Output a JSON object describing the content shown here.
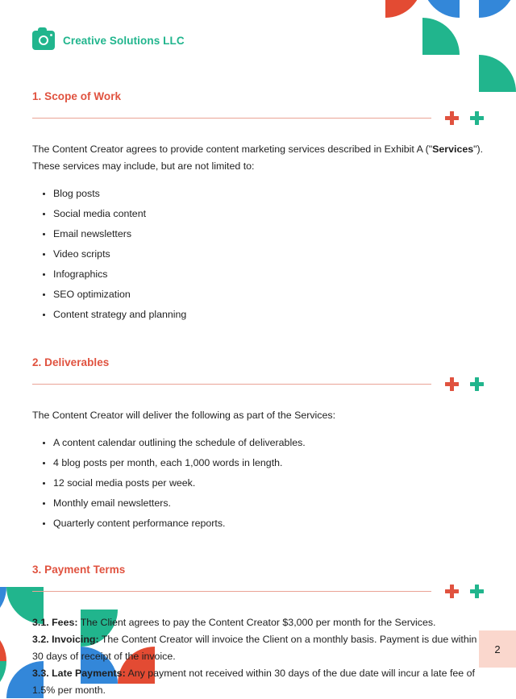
{
  "brand": {
    "name": "Creative Solutions LLC",
    "logo_icon": "camera-icon",
    "color": "#21b58d"
  },
  "theme": {
    "accent_red": "#e0523f",
    "accent_teal": "#21b58d",
    "accent_blue": "#3387d9",
    "rule_color": "#eaa396",
    "page_badge_bg": "#fad7cd"
  },
  "sections": [
    {
      "title": "1. Scope of Work",
      "intro": "The Content Creator agrees to provide content marketing services described in Exhibit A (\"Services\"). These services may include, but are not limited to:",
      "intro_pre": "The Content Creator agrees to provide content marketing services described in Exhibit A (\"",
      "intro_bold": "Services",
      "intro_post": "\"). These services may include, but are not limited to:",
      "bullets": [
        "Blog posts",
        "Social media content",
        "Email newsletters",
        "Video scripts",
        "Infographics",
        "SEO optimization",
        "Content strategy and planning"
      ]
    },
    {
      "title": "2. Deliverables",
      "intro": "The Content Creator will deliver the following as part of the Services:",
      "bullets": [
        "A content calendar outlining the schedule of deliverables.",
        "4 blog posts per month, each 1,000 words in length.",
        "12 social media posts per week.",
        "Monthly email newsletters.",
        "Quarterly content performance reports."
      ]
    },
    {
      "title": "3. Payment Terms",
      "terms": [
        {
          "label": "3.1. Fees:",
          "text": " The Client agrees to pay the Content Creator $3,000 per month for the Services."
        },
        {
          "label": "3.2. Invoicing:",
          "text": " The Content Creator will invoice the Client on a monthly basis. Payment is due within 30 days of receipt of the invoice."
        },
        {
          "label": "3.3. Late Payments:",
          "text": " Any payment not received within 30 days of the due date will incur a late fee of 1.5% per month."
        }
      ]
    }
  ],
  "page_number": "2"
}
